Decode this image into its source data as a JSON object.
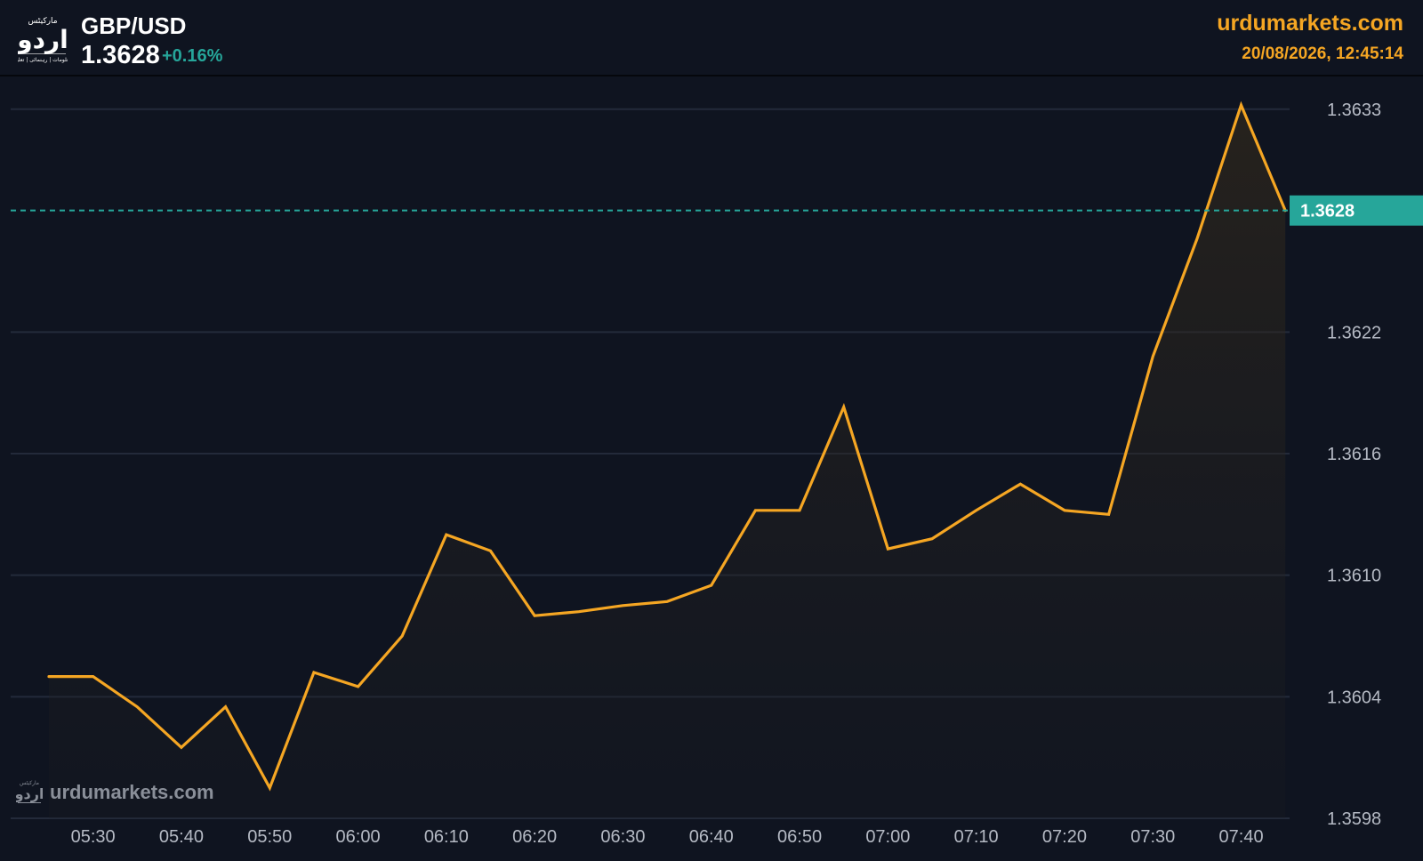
{
  "header": {
    "symbol": "GBP/USD",
    "price": "1.3628",
    "change": "+0.16%",
    "site": "urdumarkets.com",
    "datetime": "20/08/2026, 12:45:14",
    "logo_text": "اردو"
  },
  "watermark": {
    "text": "urdumarkets.com",
    "logo_text": "اردو"
  },
  "colors": {
    "background": "#0f1420",
    "line": "#f5a623",
    "accent": "#26a69a",
    "grid": "#232a3a",
    "text": "#b5bac4",
    "site": "#f5a623"
  },
  "chart_data": {
    "type": "area",
    "x": [
      "05:25",
      "05:30",
      "05:35",
      "05:40",
      "05:45",
      "05:50",
      "05:55",
      "06:00",
      "06:05",
      "06:10",
      "06:15",
      "06:20",
      "06:25",
      "06:30",
      "06:35",
      "06:40",
      "06:45",
      "06:50",
      "06:55",
      "07:00",
      "07:05",
      "07:10",
      "07:15",
      "07:20",
      "07:25",
      "07:30",
      "07:35",
      "07:40",
      "07:45"
    ],
    "series": [
      {
        "values": [
          1.3605,
          1.3605,
          1.36035,
          1.36015,
          1.36035,
          1.35995,
          1.36052,
          1.36045,
          1.3607,
          1.3612,
          1.36112,
          1.3608,
          1.36082,
          1.36085,
          1.36087,
          1.36095,
          1.36132,
          1.36132,
          1.36183,
          1.36113,
          1.36118,
          1.36132,
          1.36145,
          1.36132,
          1.3613,
          1.36208,
          1.36266,
          1.36332,
          1.3628
        ]
      }
    ],
    "x_ticks": [
      "05:30",
      "05:40",
      "05:50",
      "06:00",
      "06:10",
      "06:20",
      "06:30",
      "06:40",
      "06:50",
      "07:00",
      "07:10",
      "07:20",
      "07:30",
      "07:40"
    ],
    "y_ticks": [
      "1.3633",
      "1.3622",
      "1.3616",
      "1.3610",
      "1.3604",
      "1.3598"
    ],
    "ylim": [
      1.3598,
      1.3634
    ],
    "last_value": 1.3628,
    "last_label": "1.3628",
    "grid": true
  }
}
